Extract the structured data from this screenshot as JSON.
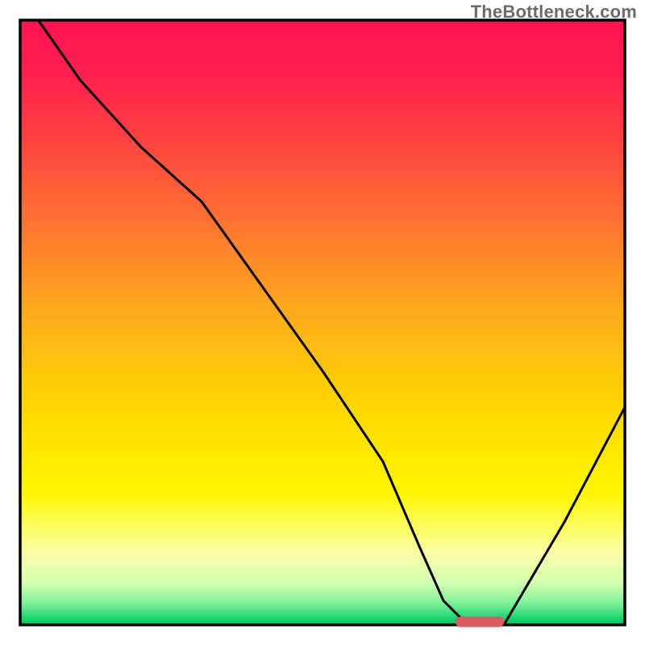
{
  "watermark": "TheBottleneck.com",
  "chart_data": {
    "type": "line",
    "title": "",
    "xlabel": "",
    "ylabel": "",
    "xlim": [
      0,
      100
    ],
    "ylim": [
      0,
      100
    ],
    "x": [
      3,
      10,
      20,
      30,
      40,
      50,
      60,
      66,
      70,
      74,
      80,
      90,
      100
    ],
    "values": [
      100,
      90,
      79,
      70,
      56,
      42,
      27,
      13,
      4,
      0,
      0,
      17,
      36
    ],
    "optimum_marker": {
      "x_start": 72,
      "x_end": 80,
      "y": 0.5
    },
    "gradient_stops": [
      {
        "offset": 0.0,
        "color": "#ff1452"
      },
      {
        "offset": 0.08,
        "color": "#ff1e4e"
      },
      {
        "offset": 0.2,
        "color": "#ff4242"
      },
      {
        "offset": 0.35,
        "color": "#ff7a30"
      },
      {
        "offset": 0.5,
        "color": "#ffb01a"
      },
      {
        "offset": 0.65,
        "color": "#ffd900"
      },
      {
        "offset": 0.78,
        "color": "#fff600"
      },
      {
        "offset": 0.88,
        "color": "#fbffa5"
      },
      {
        "offset": 0.93,
        "color": "#d4ffb3"
      },
      {
        "offset": 0.965,
        "color": "#7ef09a"
      },
      {
        "offset": 0.99,
        "color": "#17d36f"
      },
      {
        "offset": 1.0,
        "color": "#0fc162"
      }
    ],
    "curve_color": "#000000",
    "border_color": "#000000",
    "marker_color": "#d95c63"
  }
}
